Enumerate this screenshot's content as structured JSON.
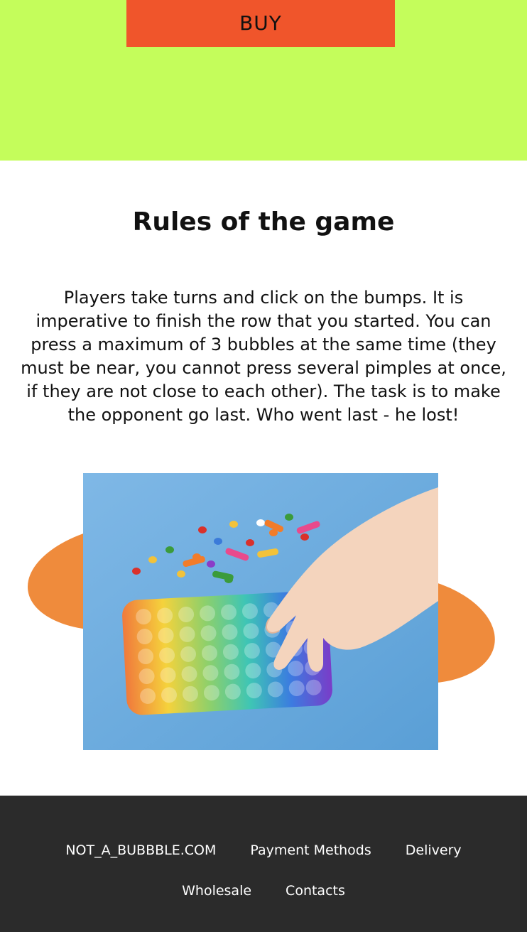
{
  "hero": {
    "buy_label": "BUY",
    "background": "#c4fd5b",
    "button_color": "#f0552b"
  },
  "rules": {
    "title": "Rules of the game",
    "text": "Players take turns and click on the bumps. It is imperative to finish the row that you started. You can press a maximum of 3 bubbles at the same time (they must be near, you cannot press several pimples at once, if they are not close to each other). The task is to make the opponent go last. Who went last - he lost!"
  },
  "illustration": {
    "blob_color": "#ef8b3c",
    "photo_icon": "pop-it-toy-photo"
  },
  "footer": {
    "background": "#2b2b2b",
    "links": [
      "NOT_A_BUBBBLE.COM",
      "Payment Methods",
      "Delivery",
      "Wholesale",
      "Contacts"
    ]
  }
}
